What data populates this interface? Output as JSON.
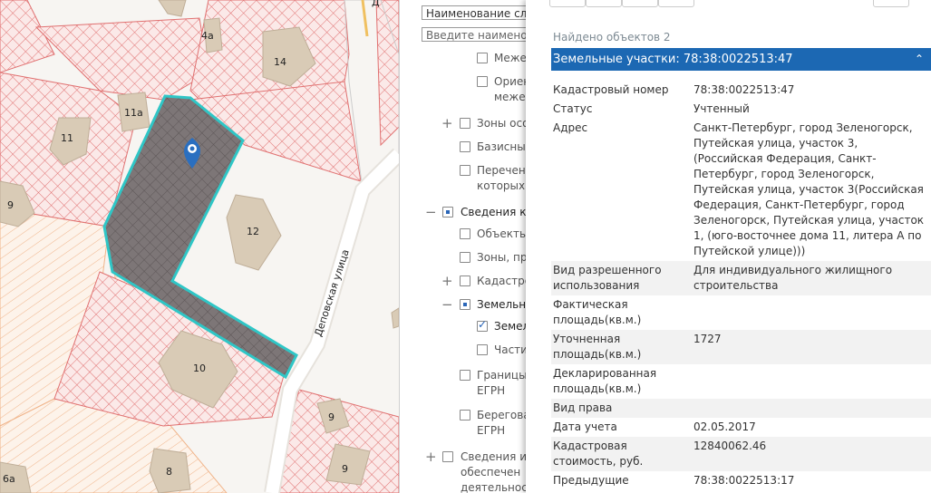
{
  "map": {
    "labels": [
      "4а",
      "14",
      "11а",
      "11",
      "9",
      "12",
      "10",
      "9",
      "9",
      "8",
      "6а",
      "Деповская улица"
    ],
    "road_label_top": "Д"
  },
  "layers": {
    "select_value": "Наименование сл",
    "search_placeholder": "Введите наименов",
    "items": [
      {
        "line1": "Меже",
        "line2": ""
      },
      {
        "line1": "Ориен",
        "line2": "межев"
      },
      {
        "line1": "Зоны осо",
        "line2": ""
      },
      {
        "line1": "Базисны",
        "line2": ""
      },
      {
        "line1": "Перечен",
        "line2": "которых"
      },
      {
        "line1": "Сведения ка",
        "line2": ""
      },
      {
        "line1": "Объекты",
        "line2": ""
      },
      {
        "line1": "Зоны, пр",
        "line2": ""
      },
      {
        "line1": "Кадастро",
        "line2": ""
      },
      {
        "line1": "Земельн",
        "line2": ""
      },
      {
        "line1": "Земел",
        "line2": ""
      },
      {
        "line1": "Частич",
        "line2": ""
      },
      {
        "line1": "Границы",
        "line2": "ЕГРН"
      },
      {
        "line1": "Берегова",
        "line2": "ЕГРН"
      },
      {
        "line1": "Сведения и",
        "line2": "обеспечен"
      },
      {
        "line1": "деятельност",
        "line2": ""
      }
    ]
  },
  "info": {
    "found_text": "Найдено объектов 2",
    "header_title": "Земельные участки: 78:38:0022513:47",
    "collapse_icon": "chevron-up-icon",
    "rows": [
      {
        "k": "Кадастровый номер",
        "v": "78:38:0022513:47"
      },
      {
        "k": "Статус",
        "v": "Учтенный"
      },
      {
        "k": "Адрес",
        "v": "Санкт-Петербург, город Зеленогорск, Путейская улица, участок 3, (Российская Федерация, Санкт-Петербург, город Зеленогорск, Путейская улица, участок 3(Российская Федерация, Санкт-Петербург, город Зеленогорск, Путейская улица, участок 1, (юго-восточнее дома 11, литера А по Путейской улице)))"
      },
      {
        "k": "Вид разрешенного использования",
        "v": "Для индивидуального жилищного строительства"
      },
      {
        "k": "Фактическая площадь(кв.м.)",
        "v": ""
      },
      {
        "k": "Уточненная площадь(кв.м.)",
        "v": "1727"
      },
      {
        "k": "Декларированная площадь(кв.м.)",
        "v": ""
      },
      {
        "k": "Вид права",
        "v": ""
      },
      {
        "k": "Дата учета",
        "v": "02.05.2017"
      },
      {
        "k": "Кадастровая стоимость, руб.",
        "v": "12840062.46"
      },
      {
        "k": "Предыдущие кадастровые номера",
        "v": "78:38:0022513:17"
      }
    ]
  },
  "colors": {
    "header_bg": "#1c68b3",
    "parcel_fill": "#7d7677",
    "parcel_border": "#2fc6c6",
    "hatch_red": "#e07070",
    "hatch_orange": "#f0b48a",
    "building": "#d9cbb6",
    "marker": "#2a6fc0"
  }
}
